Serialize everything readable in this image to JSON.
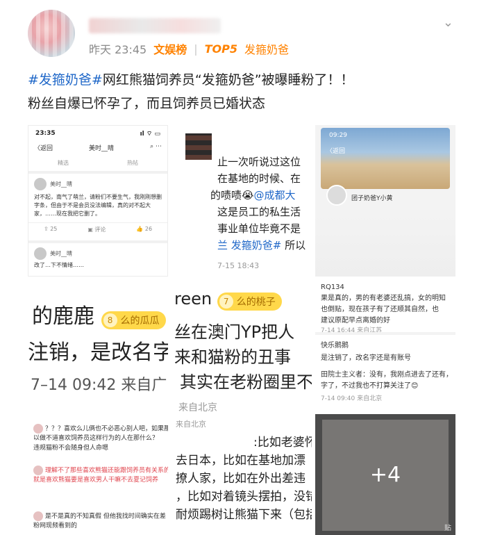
{
  "post": {
    "time": "昨天 23:45",
    "source": "文娱榜",
    "separator": "|",
    "rank": "TOP5",
    "topic": "发箍奶爸",
    "hashtag": "#发箍奶爸#",
    "text_line1": "网红熊猫饲养员“发箍奶爸”被曝睡粉了！！",
    "text_line2": "粉丝自爆已怀孕了，而且饲养员已婚状态"
  },
  "grid": {
    "c1": {
      "time": "23:35",
      "status_icons": "ıl ⌔ ▭",
      "back": "〈返回",
      "title": "美时__晴",
      "tab_left": "精选",
      "tab_right": "热帖",
      "user": "美时__晴",
      "comment": "对不起，南气了萌兰，请粉们不要生气，我刚刚想删字条，但由于不是会员没法编辑，真的对不起大家，……现在我把它删了。",
      "repost": "⇪ 25",
      "comment_count": "▣ 评论",
      "likes": "👍 26",
      "user2": "美时__晴",
      "snippet": "改了…下不情绪……"
    },
    "c2": {
      "line1": "止一次听说过这位",
      "line2": "在基地的时候、在",
      "line3_prefix": "的啧啧😭",
      "line3_at": "@成都大",
      "line4": "这是员工的私生活",
      "line5": "事业单位毕竟不是",
      "line6_link": "兰 发箍奶爸#",
      "line6_rest": "所以",
      "time": "7-15 18:43"
    },
    "c3": {
      "status": "09:29",
      "back": "〈返回",
      "name": "团子奶爸Y小黄"
    },
    "c4": {
      "line1_text": "的鹿鹿",
      "badge_num": "8",
      "badge_label": "么的瓜瓜",
      "line2": "注销，是改名字",
      "meta": "7–14 09:42  来自广"
    },
    "c5": {
      "line1_text": "reen",
      "badge_num": "7",
      "badge_label": "么的桃子",
      "line2": "丝在澳门YP把人",
      "line3": "来和猫粉的丑事",
      "line4": "其实在老粉圈里不",
      "meta": "来自北京"
    },
    "c6": {
      "user": "RQ134",
      "l1": "果是真的，男的有老婆还乱搞，女的明知",
      "l2": "也倒贴，现在孩子有了还顺其自然，也",
      "l3": "建议原配早点离婚的好",
      "l4": "7-14 16:44 来自江苏",
      "u2": "快乐鹅鹅",
      "l5": "是注销了，改名字还是有账号",
      "u3": "田院士主义者：没有，我刚点进去了还有，",
      "l6": "字了，不过我也不打算关注了😊",
      "l7": "7-14 09:40 来自北京"
    },
    "c7": {
      "l1": "？？？喜欢么儿俩也不必恶心别人吧，如果那",
      "l2": "以做不道喜欢饲养员这样行为的人在那什么？",
      "l3": "违规猫粉不会随身但人命嗯",
      "l4": "理解不了那些喜欢熊猫还能跟饲养员有关系的",
      "l5": "就是喜欢熊猫要是喜欢男人干嘛不去夏记饲养",
      "l6": "是不是真的不知真假 但他我找时间确实在差",
      "l7": "粉网现频看到的"
    },
    "c8": {
      "meta": "来自北京",
      "l1": ":比如老婆怀",
      "l2": "去日本，比如在基地加漂",
      "l3": "撩人家，比如在外出差违",
      "l4": "，比如对着镜头摆拍，没错",
      "l5": "耐烦踢树让熊猫下来（包括"
    },
    "c9": {
      "more": "+4",
      "footer": "贴"
    }
  },
  "colors": {
    "hashtag": "#1f67c8",
    "source": "#ff8200",
    "badge": "#ffd84a"
  },
  "icons": {
    "chevron": "chevron-down-icon"
  }
}
